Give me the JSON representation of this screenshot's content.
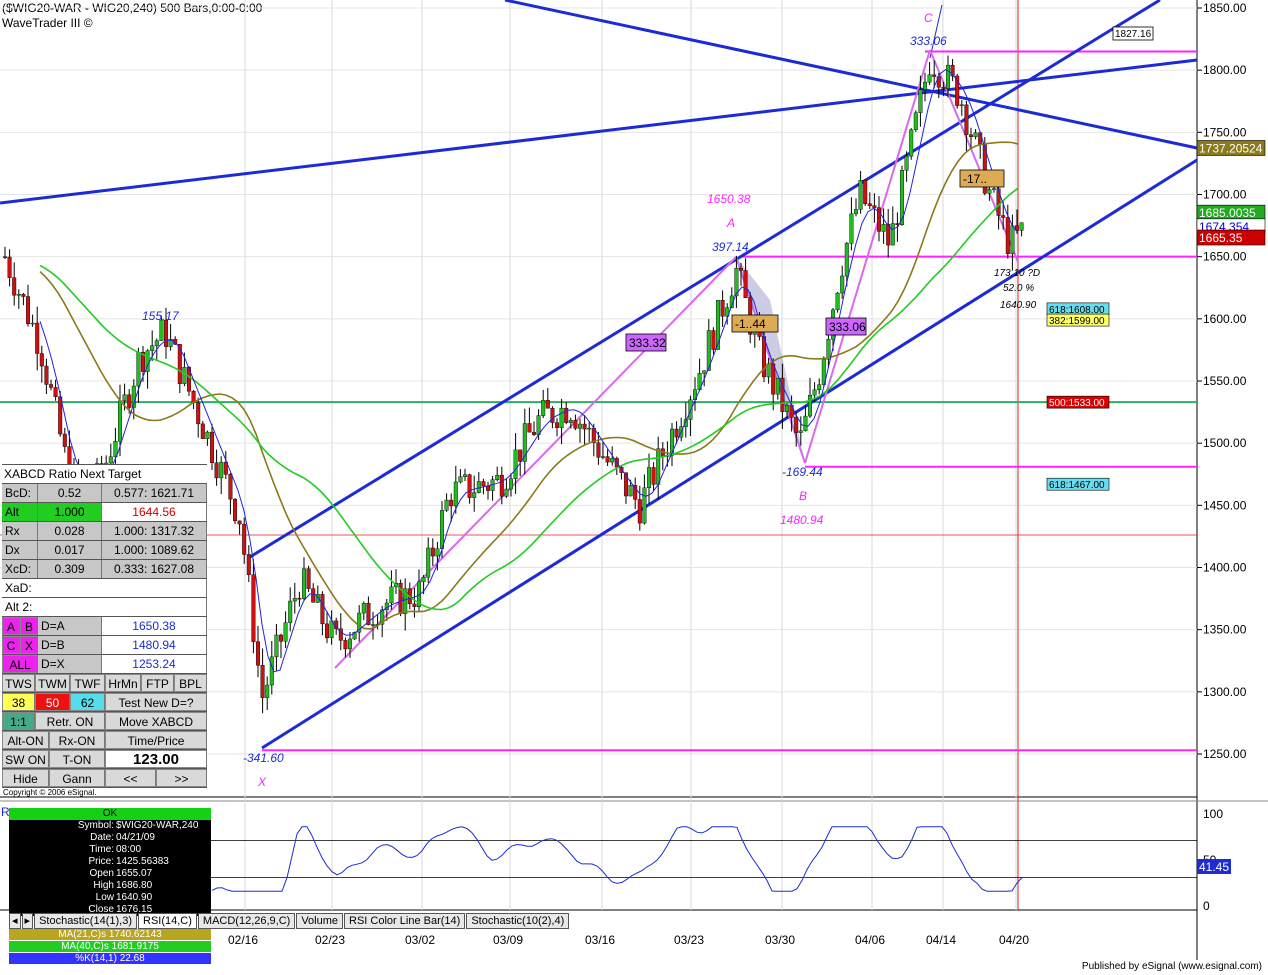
{
  "header": {
    "line1": "($WIG20-WAR - WIG20,240) 500 Bars,0:00-0:00",
    "line2": "WaveTrader III ©"
  },
  "copyright": "Copyright © 2006 eSignal.",
  "published": "Published by eSignal (www.esignal.com)",
  "chart_data": [
    {
      "type": "candlestick",
      "symbol": "$WIG20-WAR",
      "yticks": [
        1250,
        1300,
        1350,
        1400,
        1450,
        1500,
        1550,
        1600,
        1650,
        1700,
        1750,
        1800,
        1850
      ],
      "ylim": [
        1220,
        1860
      ],
      "x_labels": [
        "02/16",
        "02/23",
        "03/02",
        "03/09",
        "03/16",
        "03/23",
        "03/30",
        "04/06",
        "04/14",
        "04/20"
      ],
      "price_tags": [
        {
          "text": "1827.16",
          "price": 1827,
          "bg": "#ffffff",
          "fg": "#000000"
        },
        {
          "text": "1737.20524",
          "price": 1737,
          "bg": "#8a7a1c",
          "fg": "#ffffff"
        },
        {
          "text": "1685.0035",
          "price": 1685,
          "bg": "#22aa22",
          "fg": "#ffffff"
        },
        {
          "text": "1674.354",
          "price": 1674,
          "bg": "#ffffff",
          "fg": "#0000cc"
        },
        {
          "text": "1665.35",
          "price": 1665,
          "bg": "#cc0000",
          "fg": "#ffffff"
        }
      ],
      "fib_boxes": [
        {
          "text": "618:1608.00",
          "price": 1608,
          "bg": "#66ddee"
        },
        {
          "text": "382:1599.00",
          "price": 1599,
          "bg": "#ffff66"
        },
        {
          "text": "500:1533.00",
          "price": 1533,
          "bg": "#dd0000",
          "fg": "#ffffff"
        },
        {
          "text": "618:1467.00",
          "price": 1467,
          "bg": "#66ddee"
        }
      ],
      "horizontal_levels": [
        {
          "price": 1815,
          "color": "#ff22ff"
        },
        {
          "price": 1650,
          "color": "#ff22ff"
        },
        {
          "price": 1533,
          "color": "#33aa66"
        },
        {
          "price": 1481,
          "color": "#ff22ff"
        },
        {
          "price": 1253,
          "color": "#ff22ff"
        }
      ],
      "annotations": {
        "X": {
          "label": "X",
          "value": "-341.60"
        },
        "A": {
          "label": "A",
          "price": "1650.38",
          "value": "397.14"
        },
        "B": {
          "label": "B",
          "price": "1480.94",
          "value": "-169.44"
        },
        "C": {
          "label": "C",
          "value": "333.06"
        },
        "D": {
          "lines": [
            "173.10 ?D",
            "52.0 %",
            "1640.90"
          ]
        },
        "left_peak": "155.17",
        "boxes": [
          {
            "text": "333.32",
            "color": "#cc66ff"
          },
          {
            "text": "-1..44",
            "color": "#ddaa55"
          },
          {
            "text": "333.06",
            "color": "#cc66ff"
          },
          {
            "text": "-17..",
            "color": "#ddaa55"
          }
        ]
      }
    },
    {
      "type": "line",
      "name": "RSI(14,C)",
      "yticks": [
        0,
        50,
        100
      ],
      "last_value": "41.45",
      "levels": [
        30,
        70
      ]
    }
  ],
  "xabcd": {
    "title": "XABCD Ratio",
    "next_target": "Next Target",
    "rows": [
      {
        "label": "BcD:",
        "ratio": "0.52",
        "target": "0.577: 1621.71"
      },
      {
        "label": "Alt",
        "ratio": "1.000",
        "target": "1644.56"
      },
      {
        "label": "Rx",
        "ratio": "0.028",
        "target": "1.000: 1317.32"
      },
      {
        "label": "Dx",
        "ratio": "0.017",
        "target": "1.000: 1089.62"
      },
      {
        "label": "XcD:",
        "ratio": "0.309",
        "target": "0.333: 1627.08"
      }
    ],
    "xad": "XaD:",
    "alt2": "Alt 2:",
    "dpoints": [
      {
        "a": "A",
        "b": "B",
        "eq": "D=A",
        "val": "1650.38"
      },
      {
        "a": "C",
        "b": "X",
        "eq": "D=B",
        "val": "1480.94"
      },
      {
        "a": "ALL",
        "b": "",
        "eq": "D=X",
        "val": "1253.24"
      }
    ],
    "buttons_row1": [
      "TWS",
      "TWM",
      "TWF",
      "HrMn",
      "FTP",
      "BPL"
    ],
    "buttons_row2": [
      "38",
      "50",
      "62",
      "Test New D=?"
    ],
    "buttons_row3": [
      "1:1",
      "Retr. ON",
      "Move XABCD"
    ],
    "buttons_row4": [
      "Alt-ON",
      "Rx-ON",
      "Time/Price"
    ],
    "buttons_row5": [
      "SW ON",
      "T-ON",
      "123.00"
    ],
    "buttons_row6": [
      "Hide",
      "Gann",
      "<<",
      ">>"
    ]
  },
  "datawin": {
    "ok": "OK",
    "rows": [
      {
        "k": "Symbol:",
        "v": "$WIG20-WAR,240"
      },
      {
        "k": "Date:",
        "v": "04/21/09"
      },
      {
        "k": "Time:",
        "v": "08:00"
      },
      {
        "k": "Price:",
        "v": "1425.56383"
      },
      {
        "k": "Open",
        "v": "1655.07"
      },
      {
        "k": "High",
        "v": "1686.80"
      },
      {
        "k": "Low",
        "v": "1640.90"
      },
      {
        "k": "Close",
        "v": "1676.15"
      }
    ]
  },
  "tabs": [
    "Stochastic(14(1),3)",
    "RSI(14,C)",
    "MACD(12,26,9,C)",
    "Volume",
    "RSI Color Line Bar(14)",
    "Stochastic(10(2),4)"
  ],
  "legend": [
    {
      "text": "MA(21,C)s 1740.62143",
      "bg": "#b8a520"
    },
    {
      "text": "MA(40,C)s 1681.9175",
      "bg": "#22cc22"
    },
    {
      "text": "%K(14,1) 22.68",
      "bg": "#3333ff"
    }
  ],
  "rsi_panel_label": "R"
}
